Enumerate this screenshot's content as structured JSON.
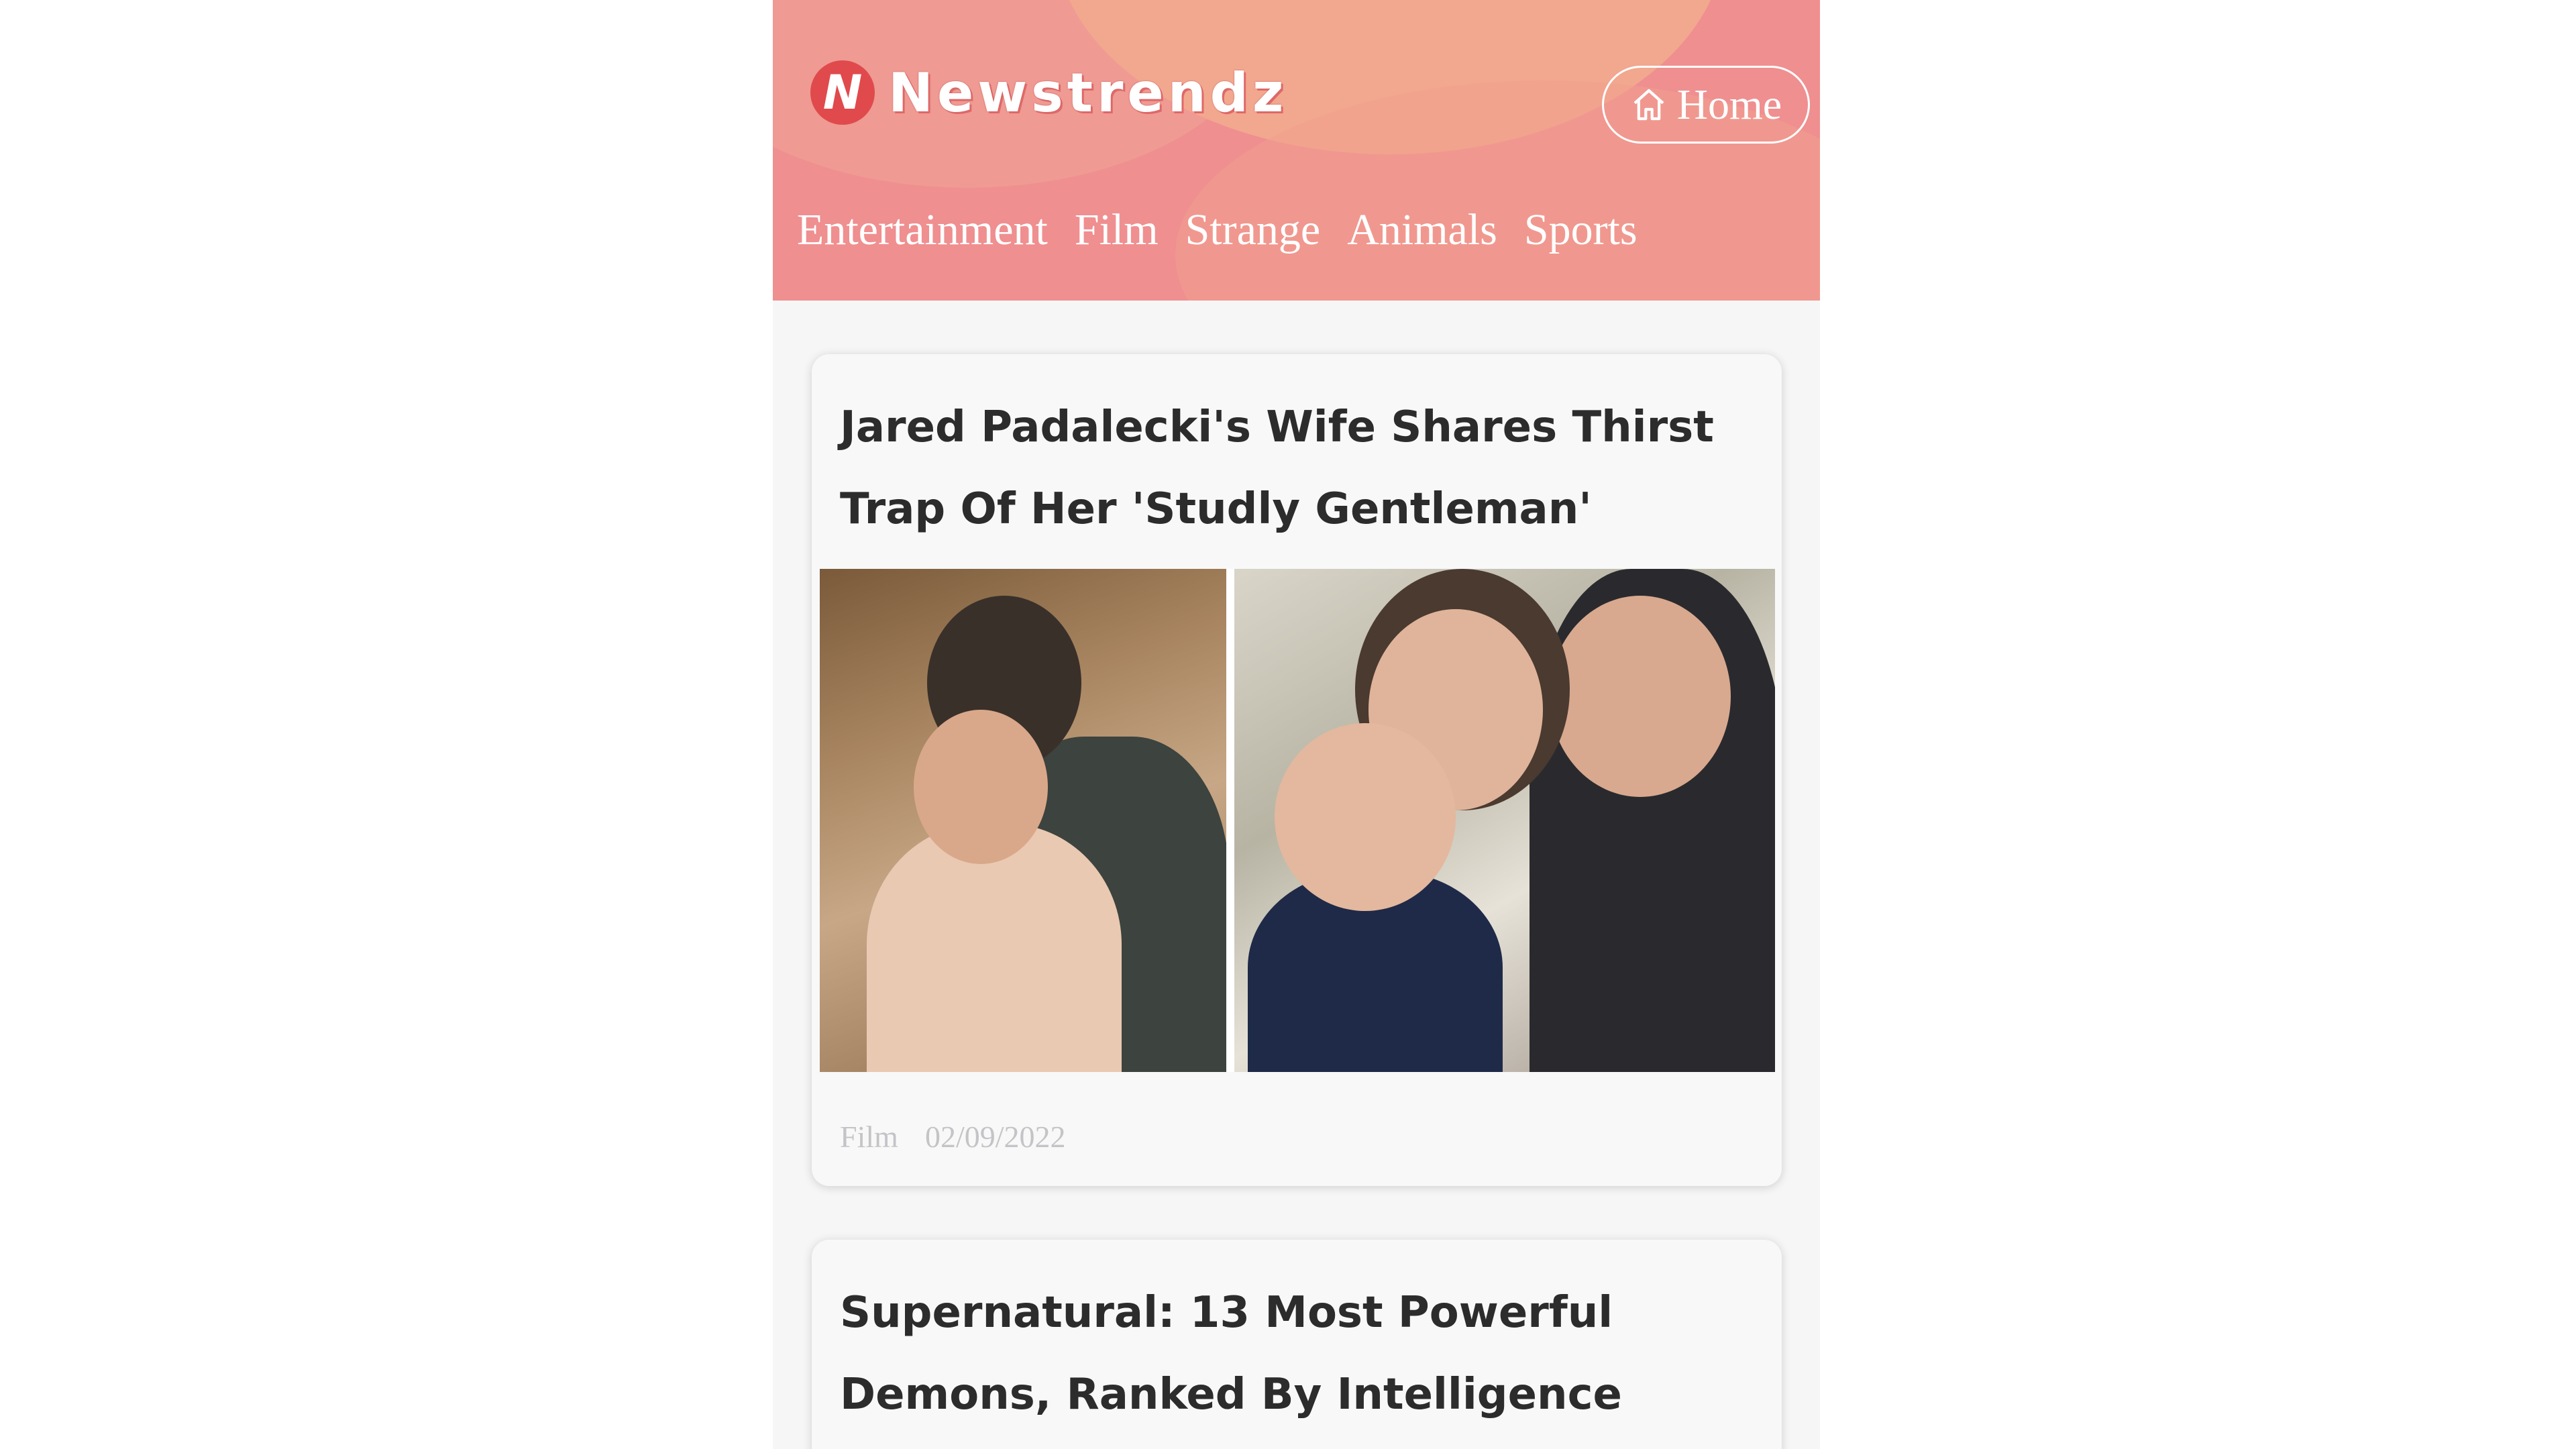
{
  "brand": {
    "logo_letter": "N",
    "name": "Newstrendz"
  },
  "header": {
    "home_label": "Home",
    "nav": [
      "Entertainment",
      "Film",
      "Strange",
      "Animals",
      "Sports"
    ]
  },
  "articles": [
    {
      "title": "Jared Padalecki's Wife Shares Thirst Trap Of Her 'Studly Gentleman'",
      "category": "Film",
      "date": "02/09/2022"
    },
    {
      "title": "Supernatural: 13 Most Powerful Demons, Ranked By Intelligence"
    }
  ],
  "colors": {
    "header_bg": "#ef8f90",
    "logo_badge": "#e04a4c",
    "title_text": "#2c2c2c",
    "meta_text": "#c4c4c8"
  }
}
